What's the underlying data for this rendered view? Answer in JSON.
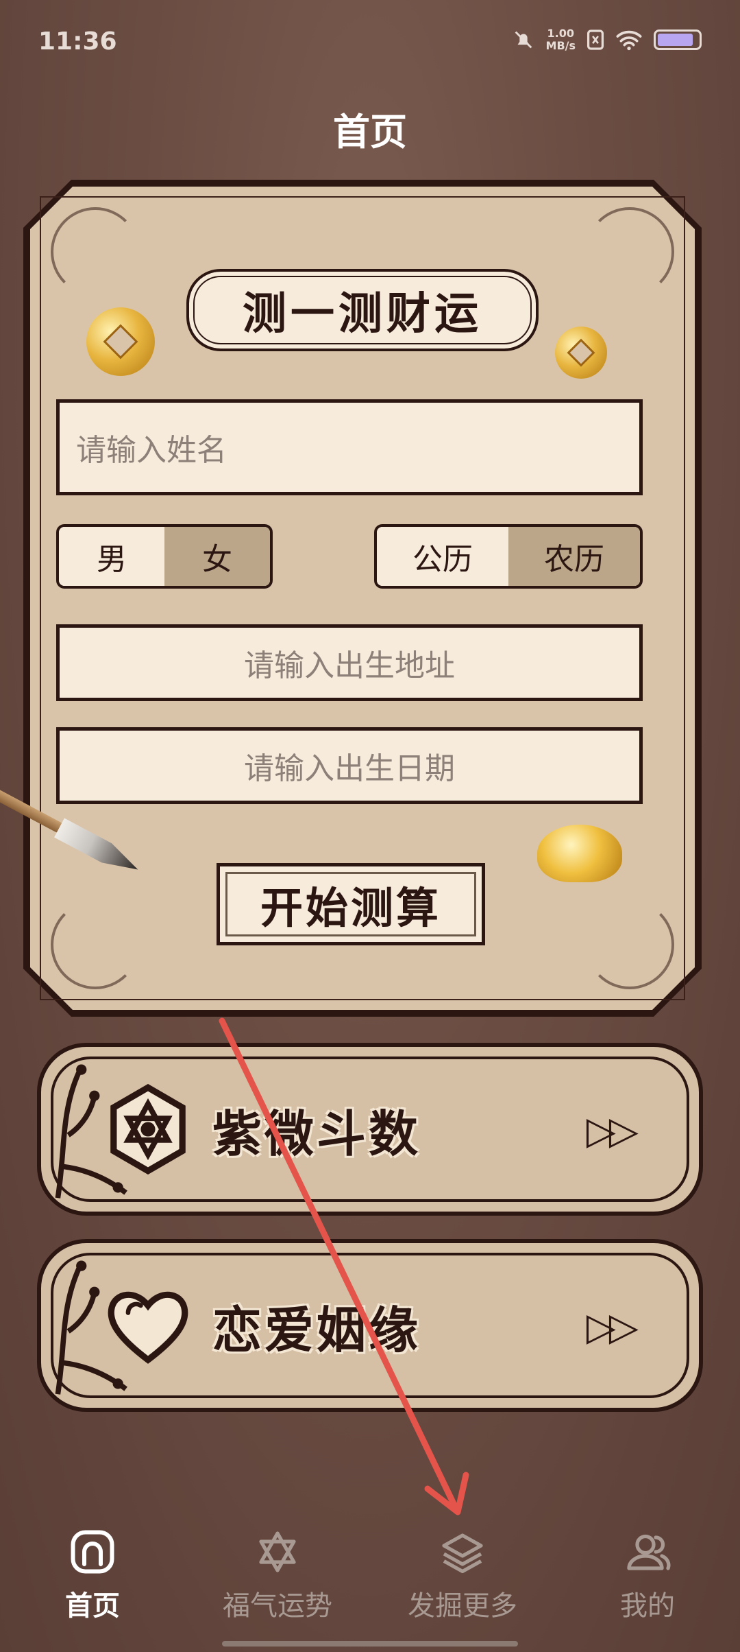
{
  "status_bar": {
    "time": "11:36",
    "net_speed_value": "1.00",
    "net_speed_unit": "MB/s"
  },
  "page": {
    "title": "首页"
  },
  "card": {
    "heading": "测一测财运",
    "name_placeholder": "请输入姓名",
    "gender_options": [
      "男",
      "女"
    ],
    "gender_selected": "男",
    "calendar_options": [
      "公历",
      "农历"
    ],
    "calendar_selected": "公历",
    "birthplace_placeholder": "请输入出生地址",
    "birthdate_placeholder": "请输入出生日期",
    "start_label": "开始测算"
  },
  "features": [
    {
      "title": "紫微斗数",
      "icon": "ziwei-emblem-icon"
    },
    {
      "title": "恋爱姻缘",
      "icon": "heart-icon"
    }
  ],
  "nav": {
    "items": [
      {
        "label": "首页",
        "icon": "home-icon",
        "active": true
      },
      {
        "label": "福气运势",
        "icon": "star-of-david-icon",
        "active": false
      },
      {
        "label": "发掘更多",
        "icon": "layers-icon",
        "active": false
      },
      {
        "label": "我的",
        "icon": "users-icon",
        "active": false
      }
    ]
  },
  "colors": {
    "background": "#6a4c42",
    "card": "#d9c4aa",
    "ink": "#2c1612",
    "pointer": "#e5544a",
    "active_nav": "#ffffff",
    "inactive_nav": "#a89a92"
  }
}
